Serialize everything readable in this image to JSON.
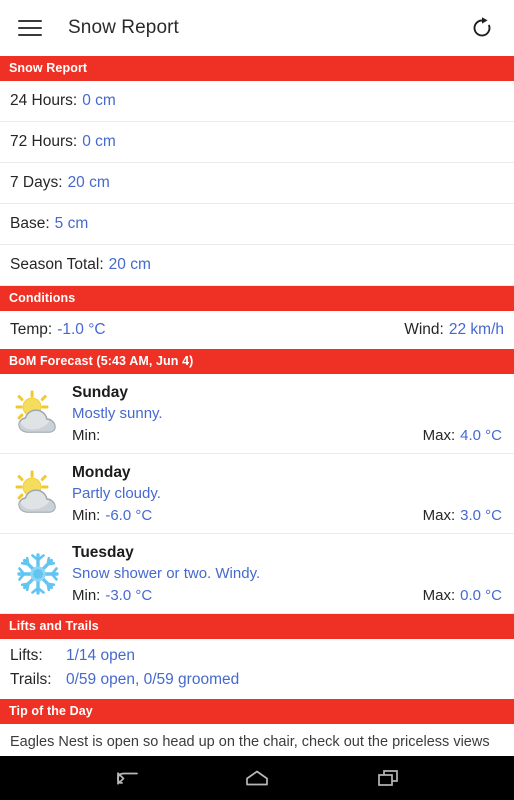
{
  "appbar": {
    "menu_icon": "hamburger-menu-icon",
    "title": "Snow Report",
    "refresh_icon": "refresh-icon"
  },
  "colors": {
    "accent_red": "#ee3124",
    "value_blue": "#4569cf",
    "text_dark": "#262626"
  },
  "snow_report": {
    "header": "Snow Report",
    "rows": [
      {
        "label": "24 Hours:",
        "value": "0 cm"
      },
      {
        "label": "72 Hours:",
        "value": "0 cm"
      },
      {
        "label": "7 Days:",
        "value": "20 cm"
      },
      {
        "label": "Base:",
        "value": "5 cm"
      },
      {
        "label": "Season Total:",
        "value": "20 cm"
      }
    ]
  },
  "conditions": {
    "header": "Conditions",
    "temp_label": "Temp:",
    "temp_value": "-1.0 °C",
    "wind_label": "Wind:",
    "wind_value": "22 km/h"
  },
  "forecast": {
    "header": "BoM Forecast (5:43 AM, Jun 4)",
    "days": [
      {
        "icon": "sun-behind-cloud-icon",
        "day": "Sunday",
        "description": "Mostly sunny.",
        "min_label": "Min:",
        "min_value": "",
        "max_label": "Max:",
        "max_value": "4.0 °C"
      },
      {
        "icon": "sun-behind-cloud-icon",
        "day": "Monday",
        "description": "Partly cloudy.",
        "min_label": "Min:",
        "min_value": "-6.0 °C",
        "max_label": "Max:",
        "max_value": "3.0 °C"
      },
      {
        "icon": "snowflake-icon",
        "day": "Tuesday",
        "description": "Snow shower or two. Windy.",
        "min_label": "Min:",
        "min_value": "-3.0 °C",
        "max_label": "Max:",
        "max_value": "0.0 °C"
      }
    ]
  },
  "lifts_and_trails": {
    "header": "Lifts and Trails",
    "lifts_label": "Lifts:",
    "lifts_value": "1/14 open",
    "trails_label": "Trails:",
    "trails_value": "0/59 open, 0/59 groomed"
  },
  "tip": {
    "header": "Tip of the Day",
    "body": "Eagles Nest is open so head up on the chair, check out the priceless views and breathe the mountain air. The top of the mountain is crisp and calm today, so warm up with a cuppa after you enjoy the snow play."
  },
  "navbar": {
    "back_icon": "back-arrow-icon",
    "home_icon": "home-icon",
    "recents_icon": "recent-apps-icon"
  }
}
